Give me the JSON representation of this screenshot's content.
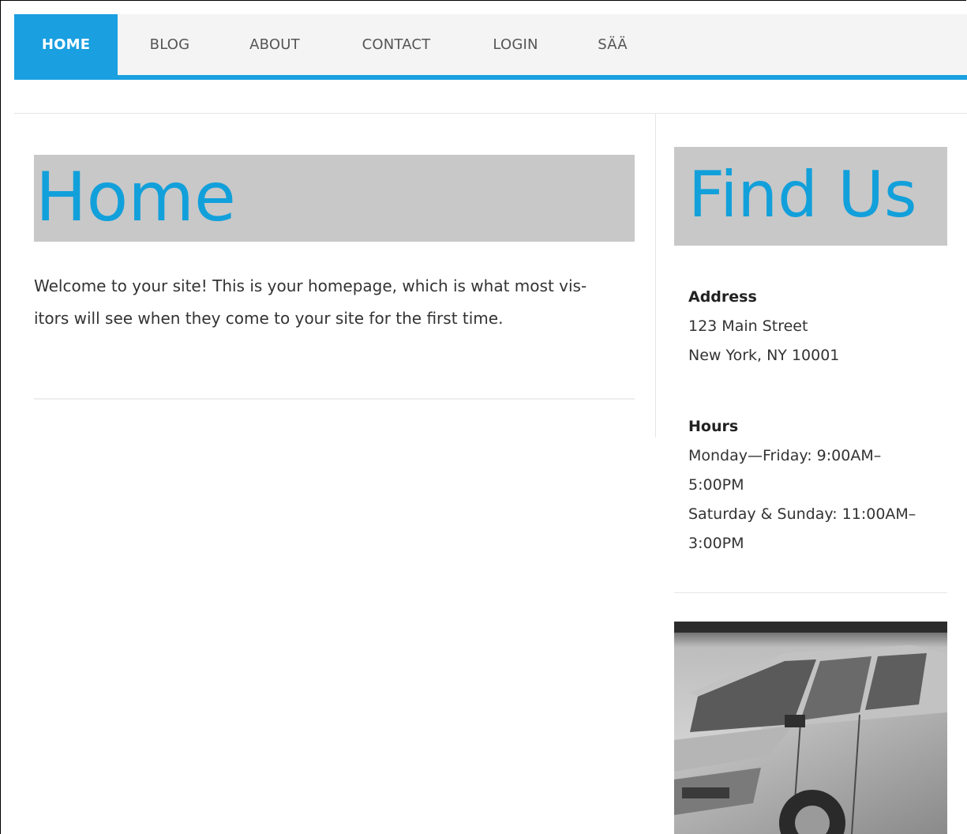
{
  "nav": {
    "items": [
      {
        "label": "HOME",
        "active": true
      },
      {
        "label": "BLOG",
        "active": false
      },
      {
        "label": "ABOUT",
        "active": false
      },
      {
        "label": "CONTACT",
        "active": false
      },
      {
        "label": "LOGIN",
        "active": false
      },
      {
        "label": "SÄÄ",
        "active": false
      }
    ]
  },
  "main": {
    "title": "Home",
    "text_line1": "Welcome to your site! This is your homepage, which is what most vis-",
    "text_line2": "itors will see when they come to your site for the first time."
  },
  "sidebar": {
    "title": "Find Us",
    "address_label": "Address",
    "address_line1": "123 Main Street",
    "address_line2": "New York, NY 10001",
    "hours_label": "Hours",
    "hours_line1": "Monday—Friday: 9:00AM–",
    "hours_line2": "5:00PM",
    "hours_line3": "Saturday & Sunday: 11:00AM–",
    "hours_line4": "3:00PM"
  },
  "colors": {
    "accent": "#1a9fe0",
    "heading_text": "#12a0db",
    "heading_bg": "#c8c8c8",
    "nav_bg": "#f4f4f4"
  }
}
